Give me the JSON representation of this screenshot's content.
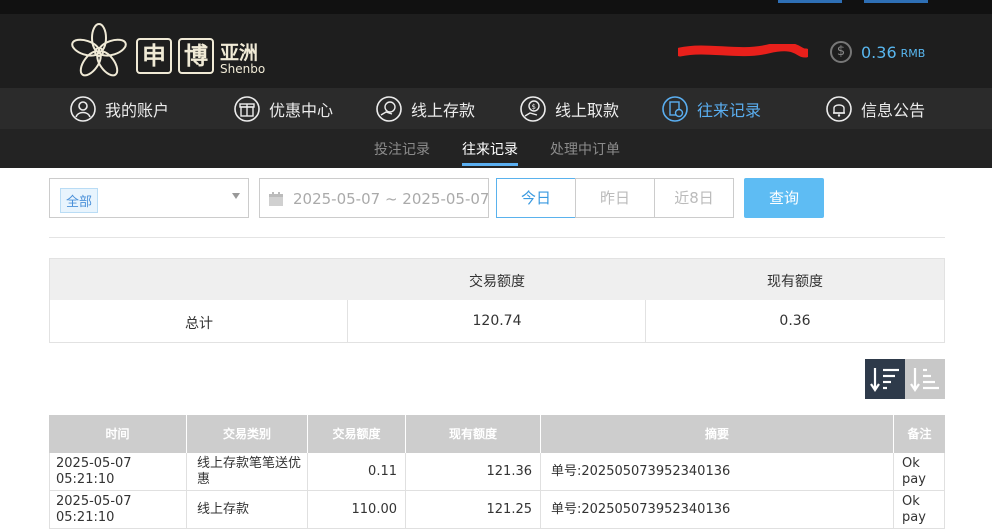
{
  "header": {
    "logo_char1": "申",
    "logo_char2": "博",
    "logo_asia": "亚洲",
    "logo_en": "Shenbo",
    "balance_amount": "0.36",
    "balance_currency": "RMB"
  },
  "nav": {
    "items": [
      {
        "label": "我的账户",
        "icon": "user-icon"
      },
      {
        "label": "优惠中心",
        "icon": "gift-icon"
      },
      {
        "label": "线上存款",
        "icon": "deposit-icon"
      },
      {
        "label": "线上取款",
        "icon": "withdraw-icon"
      },
      {
        "label": "往来记录",
        "icon": "records-icon",
        "active": true
      },
      {
        "label": "信息公告",
        "icon": "bell-icon"
      }
    ]
  },
  "subnav": {
    "items": [
      {
        "label": "投注记录"
      },
      {
        "label": "往来记录",
        "active": true
      },
      {
        "label": "处理中订单"
      }
    ]
  },
  "filter": {
    "type_value": "全部",
    "date_range": "2025-05-07 ~ 2025-05-07",
    "quick": [
      "今日",
      "昨日",
      "近8日"
    ],
    "query_label": "查询"
  },
  "summary": {
    "headers": [
      "",
      "交易额度",
      "现有额度"
    ],
    "row": [
      "总计",
      "120.74",
      "0.36"
    ]
  },
  "table": {
    "headers": [
      "时间",
      "交易类别",
      "交易额度",
      "现有额度",
      "摘要",
      "备注"
    ],
    "rows": [
      [
        "2025-05-07 05:21:10",
        "线上存款笔笔送优惠",
        "0.11",
        "121.36",
        "单号:202505073952340136",
        "Okpay"
      ],
      [
        "2025-05-07 05:21:10",
        "线上存款",
        "110.00",
        "121.25",
        "单号:202505073952340136",
        "Okpay"
      ]
    ]
  },
  "colors": {
    "accent": "#5aaef0",
    "header_bg": "#1e1e1e",
    "nav_bg": "#2b2b2b"
  }
}
